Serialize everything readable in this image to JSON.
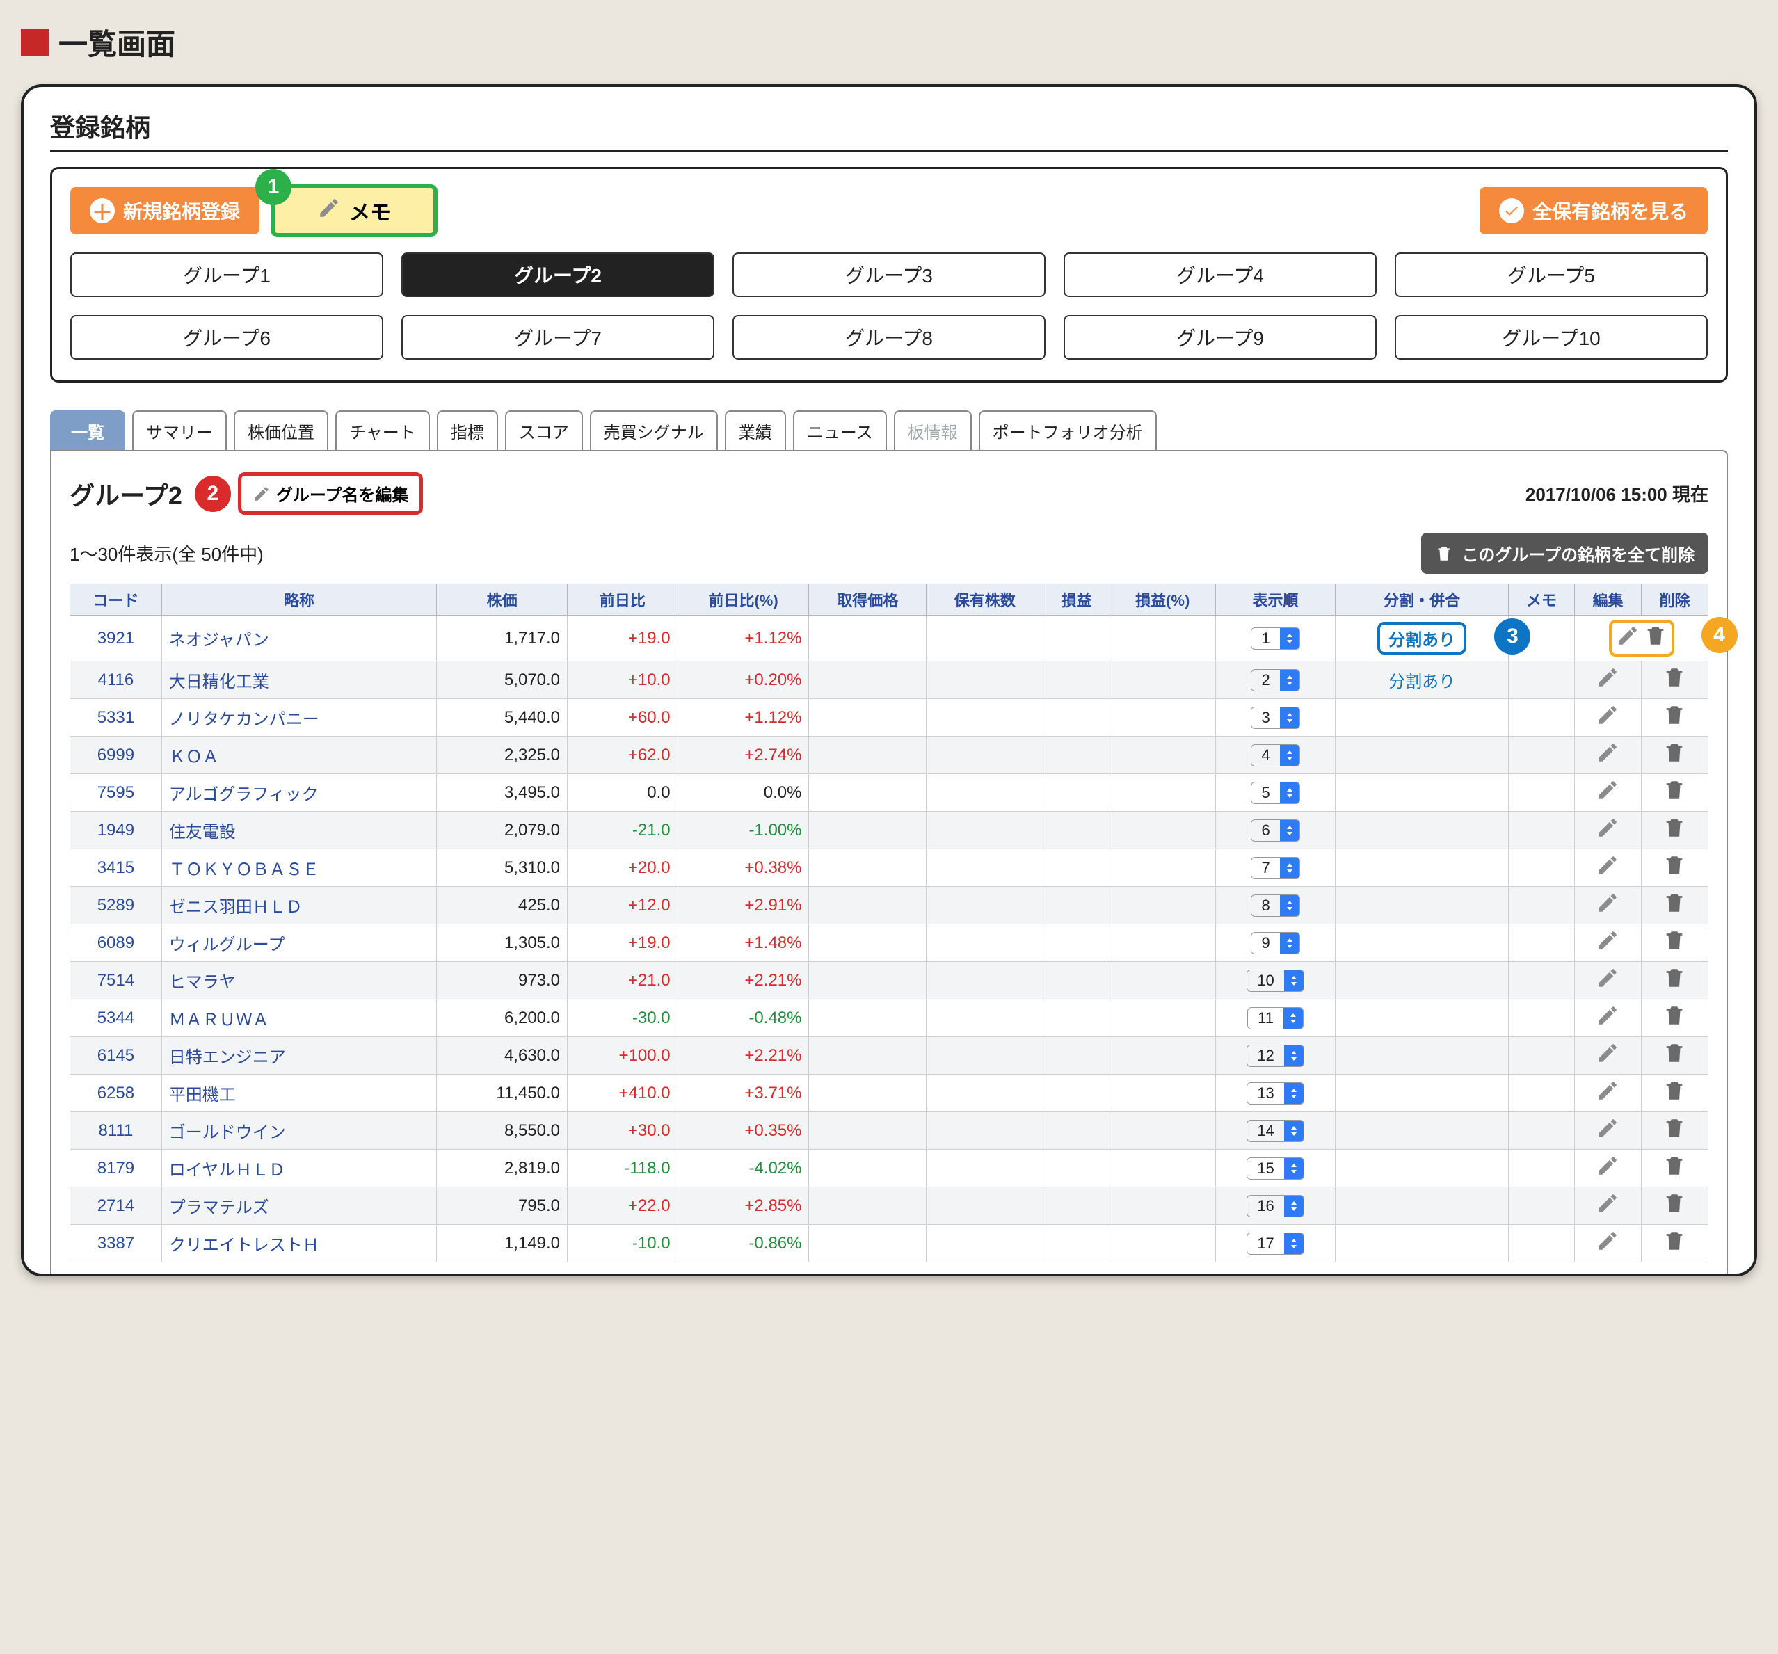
{
  "pageTitle": "一覧画面",
  "sectionTitle": "登録銘柄",
  "buttons": {
    "newRegister": "新規銘柄登録",
    "memo": "メモ",
    "viewAll": "全保有銘柄を見る",
    "editGroupName": "グループ名を編集",
    "deleteAll": "このグループの銘柄を全て削除"
  },
  "callouts": {
    "1": "1",
    "2": "2",
    "3": "3",
    "4": "4"
  },
  "groups": [
    "グループ1",
    "グループ2",
    "グループ3",
    "グループ4",
    "グループ5",
    "グループ6",
    "グループ7",
    "グループ8",
    "グループ9",
    "グループ10"
  ],
  "activeGroupIndex": 1,
  "tabs": [
    "一覧",
    "サマリー",
    "株価位置",
    "チャート",
    "指標",
    "スコア",
    "売買シグナル",
    "業績",
    "ニュース",
    "板情報",
    "ポートフォリオ分析"
  ],
  "activeTabIndex": 0,
  "disabledTabIndex": 9,
  "panelTitle": "グループ2",
  "timestamp": "2017/10/06 15:00 現在",
  "countText": "1〜30件表示(全 50件中)",
  "columns": [
    "コード",
    "略称",
    "株価",
    "前日比",
    "前日比(%)",
    "取得価格",
    "保有株数",
    "損益",
    "損益(%)",
    "表示順",
    "分割・併合",
    "メモ",
    "編集",
    "削除"
  ],
  "rows": [
    {
      "code": "3921",
      "name": "ネオジャパン",
      "price": "1,717.0",
      "diff": "+19.0",
      "pct": "+1.12%",
      "order": "1",
      "split": "分割あり",
      "splitBox": true
    },
    {
      "code": "4116",
      "name": "大日精化工業",
      "price": "5,070.0",
      "diff": "+10.0",
      "pct": "+0.20%",
      "order": "2",
      "split": "分割あり"
    },
    {
      "code": "5331",
      "name": "ノリタケカンパニー",
      "price": "5,440.0",
      "diff": "+60.0",
      "pct": "+1.12%",
      "order": "3"
    },
    {
      "code": "6999",
      "name": "ＫＯＡ",
      "price": "2,325.0",
      "diff": "+62.0",
      "pct": "+2.74%",
      "order": "4"
    },
    {
      "code": "7595",
      "name": "アルゴグラフィック",
      "price": "3,495.0",
      "diff": "0.0",
      "pct": "0.0%",
      "order": "5",
      "zero": true
    },
    {
      "code": "1949",
      "name": "住友電設",
      "price": "2,079.0",
      "diff": "-21.0",
      "pct": "-1.00%",
      "order": "6",
      "neg": true
    },
    {
      "code": "3415",
      "name": "ＴＯＫＹＯＢＡＳＥ",
      "price": "5,310.0",
      "diff": "+20.0",
      "pct": "+0.38%",
      "order": "7"
    },
    {
      "code": "5289",
      "name": "ゼニス羽田ＨＬＤ",
      "price": "425.0",
      "diff": "+12.0",
      "pct": "+2.91%",
      "order": "8"
    },
    {
      "code": "6089",
      "name": "ウィルグループ",
      "price": "1,305.0",
      "diff": "+19.0",
      "pct": "+1.48%",
      "order": "9"
    },
    {
      "code": "7514",
      "name": "ヒマラヤ",
      "price": "973.0",
      "diff": "+21.0",
      "pct": "+2.21%",
      "order": "10"
    },
    {
      "code": "5344",
      "name": "ＭＡＲＵＷＡ",
      "price": "6,200.0",
      "diff": "-30.0",
      "pct": "-0.48%",
      "order": "11",
      "neg": true
    },
    {
      "code": "6145",
      "name": "日特エンジニア",
      "price": "4,630.0",
      "diff": "+100.0",
      "pct": "+2.21%",
      "order": "12"
    },
    {
      "code": "6258",
      "name": "平田機工",
      "price": "11,450.0",
      "diff": "+410.0",
      "pct": "+3.71%",
      "order": "13"
    },
    {
      "code": "8111",
      "name": "ゴールドウイン",
      "price": "8,550.0",
      "diff": "+30.0",
      "pct": "+0.35%",
      "order": "14"
    },
    {
      "code": "8179",
      "name": "ロイヤルＨＬＤ",
      "price": "2,819.0",
      "diff": "-118.0",
      "pct": "-4.02%",
      "order": "15",
      "neg": true
    },
    {
      "code": "2714",
      "name": "プラマテルズ",
      "price": "795.0",
      "diff": "+22.0",
      "pct": "+2.85%",
      "order": "16"
    },
    {
      "code": "3387",
      "name": "クリエイトレストＨ",
      "price": "1,149.0",
      "diff": "-10.0",
      "pct": "-0.86%",
      "order": "17",
      "neg": true
    }
  ]
}
